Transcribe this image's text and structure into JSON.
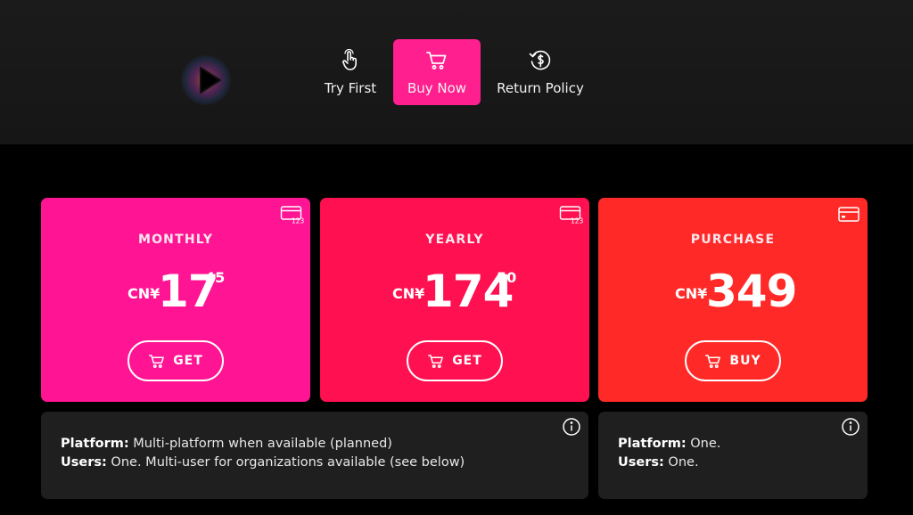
{
  "header": {
    "logo_icon": "play-triangle-icon",
    "nav": [
      {
        "label": "Try First",
        "icon": "hand-pointer-icon",
        "active": false
      },
      {
        "label": "Buy Now",
        "icon": "cart-icon",
        "active": true
      },
      {
        "label": "Return Policy",
        "icon": "refund-dollar-icon",
        "active": false
      }
    ],
    "active_color": "#ff1f8e"
  },
  "plans": [
    {
      "title": "MONTHLY",
      "currency": "CN¥",
      "price_main": "17",
      "price_fraction": "45",
      "button_label": "GET",
      "corner_icon": "card-123-icon",
      "corner_icon_text": "123",
      "color": "#ff1493"
    },
    {
      "title": "YEARLY",
      "currency": "CN¥",
      "price_main": "174",
      "price_fraction": "50",
      "button_label": "GET",
      "corner_icon": "card-123-icon",
      "corner_icon_text": "123",
      "color": "#ff1050"
    },
    {
      "title": "PURCHASE",
      "currency": "CN¥",
      "price_main": "349",
      "price_fraction": "",
      "button_label": "BUY",
      "corner_icon": "credit-card-icon",
      "color": "#ff2a27"
    }
  ],
  "info": {
    "subscription": {
      "platform_label": "Platform:",
      "platform_value": " Multi-platform when available (planned)",
      "users_label": "Users:",
      "users_value": " One. Multi-user for organizations available (see below)"
    },
    "purchase": {
      "platform_label": "Platform:",
      "platform_value": " One.",
      "users_label": "Users:",
      "users_value": " One."
    }
  }
}
